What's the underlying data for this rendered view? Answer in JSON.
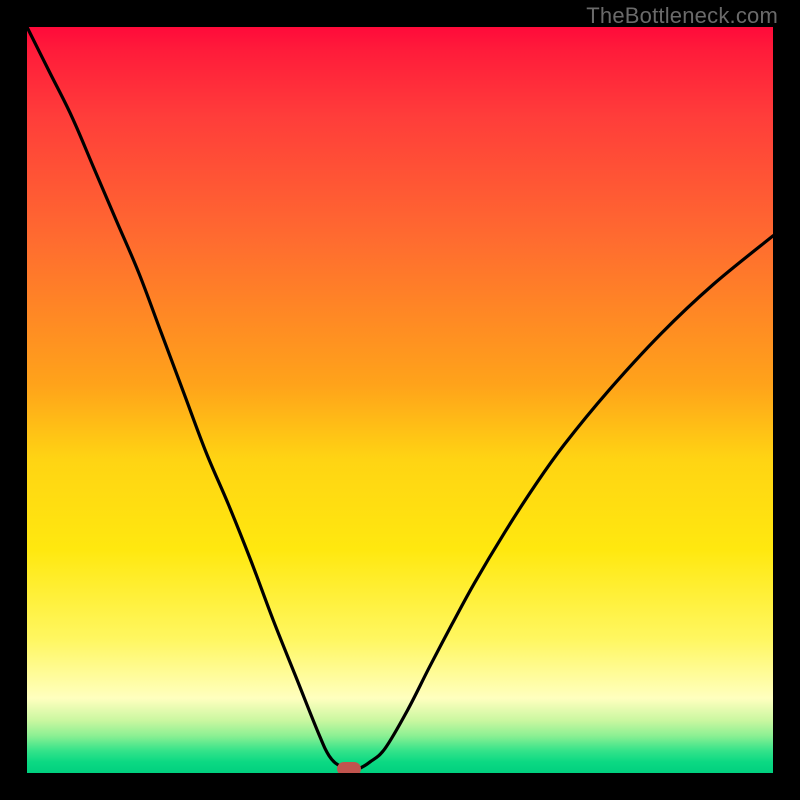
{
  "watermark": "TheBottleneck.com",
  "colors": {
    "background": "#000000",
    "curve_stroke": "#000000",
    "marker_fill": "#c1544e"
  },
  "chart_data": {
    "type": "line",
    "title": "",
    "xlabel": "",
    "ylabel": "",
    "xlim": [
      0,
      100
    ],
    "ylim": [
      0,
      100
    ],
    "grid": false,
    "legend": null,
    "series": [
      {
        "name": "bottleneck-curve",
        "x": [
          0,
          3,
          6,
          9,
          12,
          15,
          18,
          21,
          24,
          27,
          30,
          33,
          36,
          39,
          40.5,
          42,
          43.5,
          44.5,
          46,
          48,
          51,
          54,
          57,
          60,
          64,
          68,
          72,
          78,
          85,
          92,
          100
        ],
        "values": [
          100,
          94,
          88,
          81,
          74,
          67,
          59,
          51,
          43,
          36,
          28.5,
          20.5,
          13,
          5.5,
          2.3,
          0.9,
          0.5,
          0.6,
          1.5,
          3.3,
          8.4,
          14.3,
          20,
          25.5,
          32.2,
          38.4,
          44,
          51.3,
          58.9,
          65.5,
          72
        ]
      }
    ],
    "marker": {
      "x": 43.2,
      "y": 0.5,
      "shape": "pill"
    }
  }
}
